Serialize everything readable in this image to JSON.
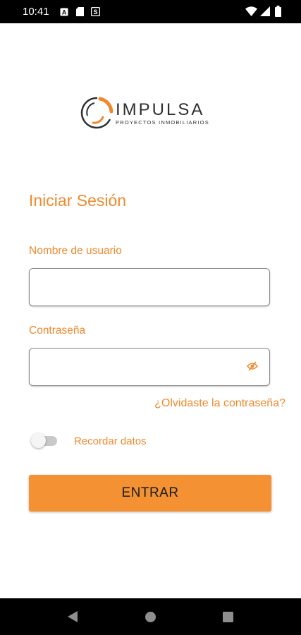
{
  "status_bar": {
    "time": "10:41",
    "notification_icons": [
      "a-icon",
      "sim-card-icon",
      "s-circle-icon"
    ],
    "system_icons": [
      "wifi-icon",
      "signal-icon",
      "battery-icon"
    ]
  },
  "logo": {
    "name": "IMPULSA",
    "tagline": "PROYECTOS INMOBILIARIOS",
    "accent_color": "#f0892e"
  },
  "login": {
    "title": "Iniciar Sesión",
    "username_label": "Nombre de usuario",
    "username_value": "",
    "password_label": "Contraseña",
    "password_value": "",
    "password_toggle_icon": "eye-off-icon",
    "forgot_link": "¿Olvidaste la contraseña?",
    "remember_label": "Recordar datos",
    "remember_on": false,
    "submit_label": "ENTRAR"
  },
  "colors": {
    "accent": "#f0892e",
    "button": "#f39133"
  },
  "nav_bar": {
    "buttons": [
      "back-icon",
      "home-icon",
      "recents-icon"
    ]
  }
}
